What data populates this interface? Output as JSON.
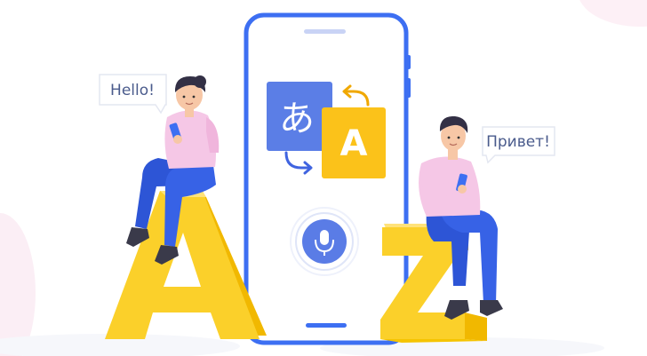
{
  "bubbles": {
    "left": "Hello!",
    "right": "Привет!"
  },
  "translation_card": {
    "source_glyph": "あ",
    "target_glyph": "A"
  },
  "letters": {
    "left": "A",
    "right": "Z"
  },
  "colors": {
    "phone_border": "#3d6ff2",
    "card_blue": "#5b7ee6",
    "card_yellow": "#fbc21a",
    "letter_yellow": "#fbd02a",
    "shirt_pink": "#f5c7e6",
    "jeans_blue": "#2d55d6",
    "mic_blue": "#5a7ce6"
  },
  "icons": [
    "translate-card-icon",
    "microphone-icon",
    "arrow-right-icon",
    "arrow-left-icon",
    "smartphone-icon"
  ]
}
